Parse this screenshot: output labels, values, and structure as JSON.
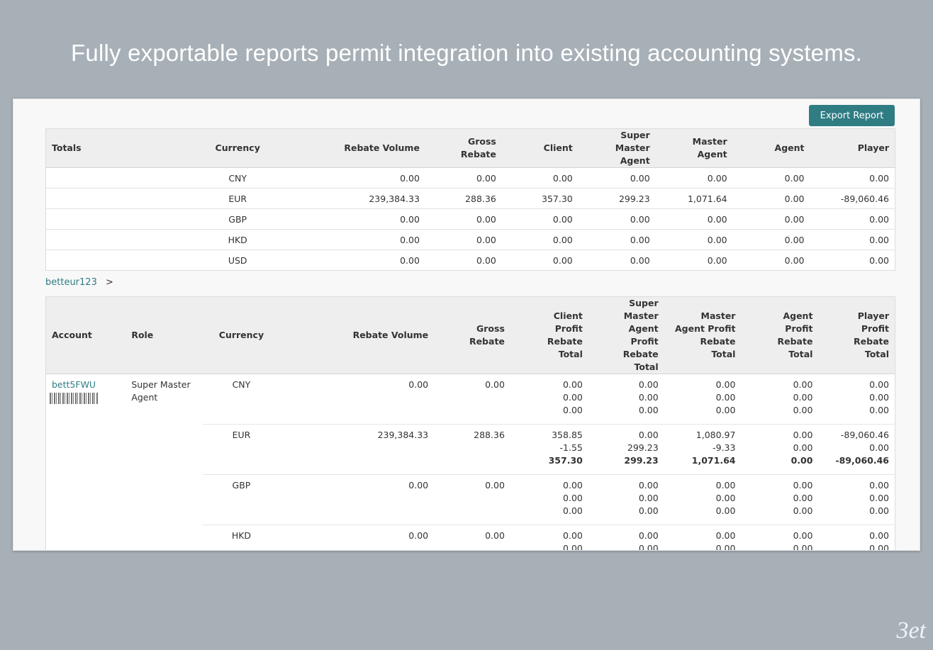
{
  "headline": "Fully exportable reports permit integration into existing accounting systems.",
  "export_button": "Export Report",
  "totals_table": {
    "headers": [
      "Totals",
      "Currency",
      "Rebate Volume",
      "Gross Rebate",
      "Client",
      "Super Master Agent",
      "Master Agent",
      "Agent",
      "Player"
    ],
    "rows": [
      {
        "currency": "CNY",
        "rebate_volume": "0.00",
        "gross_rebate": "0.00",
        "client": "0.00",
        "super_master_agent": "0.00",
        "master_agent": "0.00",
        "agent": "0.00",
        "player": "0.00"
      },
      {
        "currency": "EUR",
        "rebate_volume": "239,384.33",
        "gross_rebate": "288.36",
        "client": "357.30",
        "super_master_agent": "299.23",
        "master_agent": "1,071.64",
        "agent": "0.00",
        "player": "-89,060.46"
      },
      {
        "currency": "GBP",
        "rebate_volume": "0.00",
        "gross_rebate": "0.00",
        "client": "0.00",
        "super_master_agent": "0.00",
        "master_agent": "0.00",
        "agent": "0.00",
        "player": "0.00"
      },
      {
        "currency": "HKD",
        "rebate_volume": "0.00",
        "gross_rebate": "0.00",
        "client": "0.00",
        "super_master_agent": "0.00",
        "master_agent": "0.00",
        "agent": "0.00",
        "player": "0.00"
      },
      {
        "currency": "USD",
        "rebate_volume": "0.00",
        "gross_rebate": "0.00",
        "client": "0.00",
        "super_master_agent": "0.00",
        "master_agent": "0.00",
        "agent": "0.00",
        "player": "0.00"
      }
    ]
  },
  "breadcrumb": {
    "link": "betteur123",
    "separator": ">"
  },
  "detail_table": {
    "headers": {
      "account": "Account",
      "role": "Role",
      "currency": "Currency",
      "rebate_volume": "Rebate Volume",
      "gross_rebate": "Gross Rebate",
      "client": "Client Profit Rebate Total",
      "super_master_agent": "Super Master Agent Profit Rebate Total",
      "master_agent": "Master Agent Profit Rebate Total",
      "agent": "Agent Profit Rebate Total",
      "player": "Player Profit Rebate Total"
    },
    "account": {
      "name": "bett5FWU",
      "role": "Super Master Agent"
    },
    "rows": [
      {
        "currency": "CNY",
        "rebate_volume": "0.00",
        "gross_rebate": "0.00",
        "client": [
          "0.00",
          "0.00",
          "0.00"
        ],
        "super_master_agent": [
          "0.00",
          "0.00",
          "0.00"
        ],
        "master_agent": [
          "0.00",
          "0.00",
          "0.00"
        ],
        "agent": [
          "0.00",
          "0.00",
          "0.00"
        ],
        "player": [
          "0.00",
          "0.00",
          "0.00"
        ]
      },
      {
        "currency": "EUR",
        "rebate_volume": "239,384.33",
        "gross_rebate": "288.36",
        "client": [
          "358.85",
          "-1.55",
          "357.30"
        ],
        "super_master_agent": [
          "0.00",
          "299.23",
          "299.23"
        ],
        "master_agent": [
          "1,080.97",
          "-9.33",
          "1,071.64"
        ],
        "agent": [
          "0.00",
          "0.00",
          "0.00"
        ],
        "player": [
          "-89,060.46",
          "0.00",
          "-89,060.46"
        ]
      },
      {
        "currency": "GBP",
        "rebate_volume": "0.00",
        "gross_rebate": "0.00",
        "client": [
          "0.00",
          "0.00",
          "0.00"
        ],
        "super_master_agent": [
          "0.00",
          "0.00",
          "0.00"
        ],
        "master_agent": [
          "0.00",
          "0.00",
          "0.00"
        ],
        "agent": [
          "0.00",
          "0.00",
          "0.00"
        ],
        "player": [
          "0.00",
          "0.00",
          "0.00"
        ]
      },
      {
        "currency": "HKD",
        "rebate_volume": "0.00",
        "gross_rebate": "0.00",
        "client": [
          "0.00",
          "0.00"
        ],
        "super_master_agent": [
          "0.00",
          "0.00"
        ],
        "master_agent": [
          "0.00",
          "0.00"
        ],
        "agent": [
          "0.00",
          "0.00"
        ],
        "player": [
          "0.00",
          "0.00"
        ]
      }
    ]
  },
  "logo": "3et"
}
